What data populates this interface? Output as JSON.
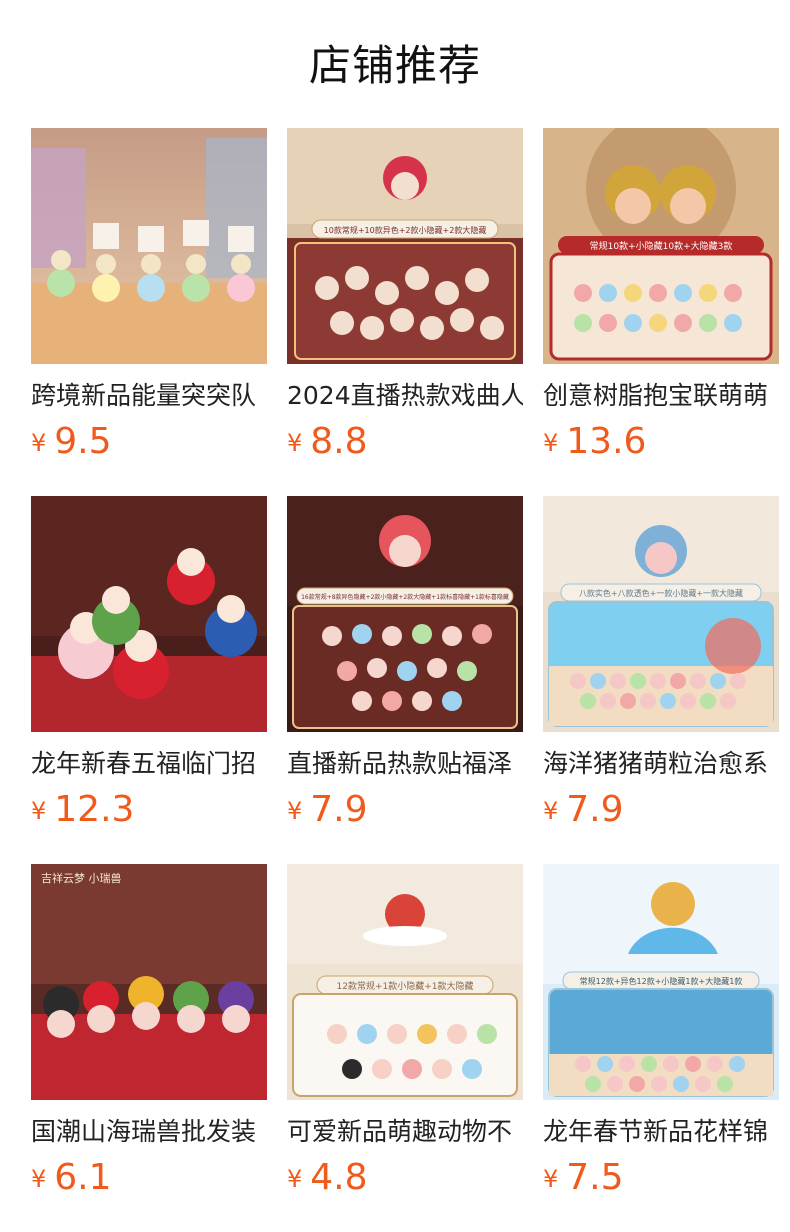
{
  "header": {
    "title": "店铺推荐"
  },
  "currency_symbol": "¥",
  "colors": {
    "price": "#f05a1a",
    "title": "#111111"
  },
  "products": [
    {
      "name": "跨境新品能量突突队",
      "price": "9.5",
      "image_text": ""
    },
    {
      "name": "2024直播热款戏曲人",
      "price": "8.8",
      "image_text": "10款常规+10款异色+2款小隐藏+2款大隐藏"
    },
    {
      "name": "创意树脂抱宝联萌萌",
      "price": "13.6",
      "image_text": "常规10款+小隐藏10款+大隐藏3款"
    },
    {
      "name": "龙年新春五福临门招",
      "price": "12.3",
      "image_text": ""
    },
    {
      "name": "直播新品热款贴福泽",
      "price": "7.9",
      "image_text": "16款常规+8款异色隐藏+2款小隐藏+2款大隐藏+1款标喜隐藏+1款标喜隐藏"
    },
    {
      "name": "海洋猪猪萌粒治愈系",
      "price": "7.9",
      "image_text": "八款实色+八款透色+一款小隐藏+一款大隐藏"
    },
    {
      "name": "国潮山海瑞兽批发装",
      "price": "6.1",
      "image_text": "吉祥云梦 小瑞兽"
    },
    {
      "name": "可爱新品萌趣动物不",
      "price": "4.8",
      "image_text": "12款常规+1款小隐藏+1款大隐藏"
    },
    {
      "name": "龙年春节新品花样锦",
      "price": "7.5",
      "image_text": "常规12款+异色12款+小隐藏1款+大隐藏1款"
    }
  ]
}
